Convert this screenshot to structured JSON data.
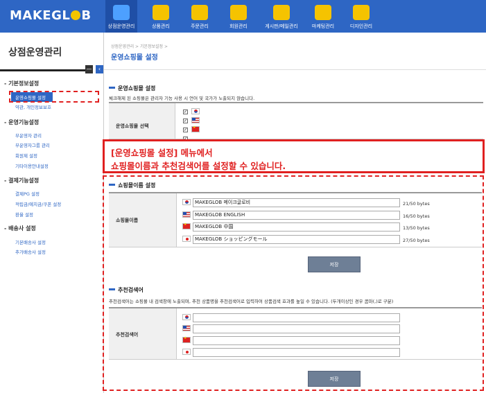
{
  "header": {
    "logo_text_a": "MAKE",
    "logo_text_b": "GL",
    "logo_text_c": "B",
    "nav": [
      {
        "label": "상점운영관리",
        "icon": "home-icon"
      },
      {
        "label": "상품관리",
        "icon": "tag-icon"
      },
      {
        "label": "주문관리",
        "icon": "won-icon"
      },
      {
        "label": "회원관리",
        "icon": "people-icon"
      },
      {
        "label": "게시판/메일관리",
        "icon": "cup-icon"
      },
      {
        "label": "마케팅관리",
        "icon": "chart-icon"
      },
      {
        "label": "디자인관리",
        "icon": "palette-icon"
      }
    ]
  },
  "sidebar": {
    "title": "상점운영관리",
    "sections": [
      {
        "title": "기본정보설정",
        "items": [
          "운영쇼핑몰 설정",
          "약관, 개인정보보호"
        ]
      },
      {
        "title": "운영기능설정",
        "items": [
          "부운영자 관리",
          "부운영자그룹 관리",
          "회원제 설정",
          "기타이용안내설정"
        ]
      },
      {
        "title": "결제기능설정",
        "items": [
          "결제PG 설정",
          "적립금/예치금/쿠폰 설정",
          "환율 설정"
        ]
      },
      {
        "title": "배송사 설정",
        "items": [
          "기본배송사 설정",
          "추가배송사 설정"
        ]
      }
    ]
  },
  "main": {
    "breadcrumb": "상점운영관리 > 기본정보설정 >",
    "page_title": "운영쇼핑몰 설정",
    "section1": {
      "title": "운영쇼핑몰 설정",
      "desc": "체크해제 된 쇼핑몰은 관리자 기능 사용 시 언어 및 국가가 노출되지 않습니다.",
      "label": "운영쇼핑몰 선택"
    },
    "callout": {
      "line1": "[운영쇼핑몰 설정] 메뉴에서",
      "line2": "쇼핑몰이름과 추천검색어를 설정할 수 있습니다."
    },
    "section2": {
      "title": "쇼핑몰이름 설정",
      "label": "쇼핑몰이름",
      "rows": [
        {
          "flag": "kr-flag-icon",
          "value": "MAKEGLOB 메이크글로비",
          "bytes": "21/50 bytes"
        },
        {
          "flag": "us-flag-icon",
          "value": "MAKEGLOB ENGLISH",
          "bytes": "16/50 bytes"
        },
        {
          "flag": "cn-flag-icon",
          "value": "MAKEGLOB 中国",
          "bytes": "13/50 bytes"
        },
        {
          "flag": "jp-flag-icon",
          "value": "MAKEGLOB ショッピングモール",
          "bytes": "27/50 bytes"
        }
      ],
      "save_label": "저장"
    },
    "section3": {
      "title": "추천검색어",
      "desc": "추천검색어는 쇼핑몰 내 검색창에 노출되며, 추천 상품명을 추천검색어로 입력하여 상품검색 효과를 높일 수 있습니다. (두개이상인 경우 콤마(,)로 구분)",
      "label": "추천검색어",
      "save_label": "저장"
    }
  },
  "colors": {
    "header": "#2e66c4",
    "accent": "#2e66c4",
    "annotation": "#e02020"
  }
}
